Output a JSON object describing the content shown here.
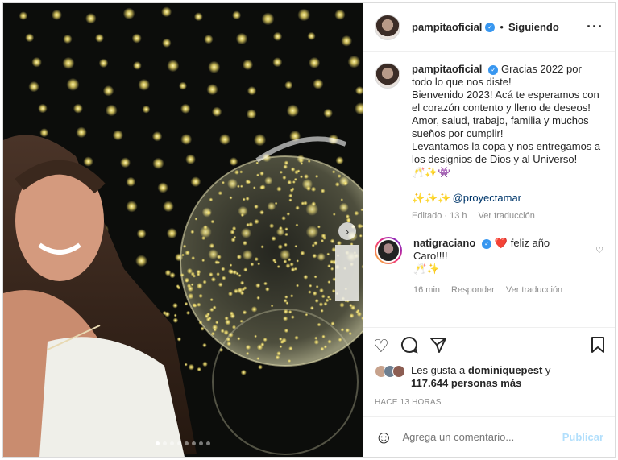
{
  "post": {
    "username": "pampitaoficial",
    "follow_status": "Siguiendo",
    "more_icon": "more-horizontal-icon"
  },
  "caption": {
    "username": "pampitaoficial",
    "lines": [
      "Gracias 2022 por todo lo que nos diste!",
      "Bienvenido 2023! Acá te esperamos con el corazón contento y lleno de deseos!",
      "Amor, salud, trabajo, familia y muchos sueños por cumplir!",
      "Levantamos la copa y nos entregamos a los designios de Dios y al Universo!"
    ],
    "emojis_line1": "🥂✨👾",
    "emojis_line2": "✨✨✨",
    "mention": "@proyectamar",
    "edited": "Editado · 13 h",
    "see_translation": "Ver traducción"
  },
  "comment": {
    "username": "natigraciano",
    "heart_emoji": "❤️",
    "text": "feliz año Caro!!!!",
    "emojis": "🥂✨",
    "time": "16 min",
    "reply": "Responder",
    "see_translation": "Ver traducción"
  },
  "likes": {
    "prefix": "Les gusta a",
    "user": "dominiquepest",
    "and": "y",
    "others": "117.644 personas más"
  },
  "timestamp": "HACE 13 HORAS",
  "add_comment": {
    "placeholder": "Agrega un comentario...",
    "publish": "Publicar"
  },
  "carousel": {
    "count": 8,
    "active_index": 0
  },
  "colors": {
    "verified": "#3897f0",
    "publish_disabled": "#b2dffc",
    "mention": "#00376b"
  }
}
